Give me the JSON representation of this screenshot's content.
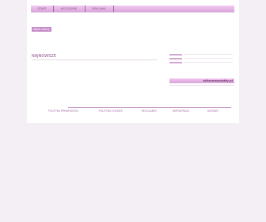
{
  "nav": {
    "items": [
      {
        "label": "Start"
      },
      {
        "label": "Kategorie"
      },
      {
        "label": "Reklama"
      }
    ]
  },
  "badge": {
    "label": "Zgłoś stronę"
  },
  "main": {
    "section_title": "Najnowsze"
  },
  "sidebar": {
    "title": "elitarnewsletty.pl"
  },
  "footer": {
    "links": [
      {
        "label": "Polityka prywatności"
      },
      {
        "label": "Polityka cookies"
      },
      {
        "label": "Regulamin"
      },
      {
        "label": "Współpraca"
      },
      {
        "label": "Kontakt"
      }
    ],
    "copyright": ""
  },
  "colors": {
    "background": "#f4eff4",
    "nav_gradient_top": "#f0c9ef",
    "nav_gradient_bottom": "#dba6dc",
    "accent": "#c78ccb",
    "title_text": "#8a4d8e"
  }
}
